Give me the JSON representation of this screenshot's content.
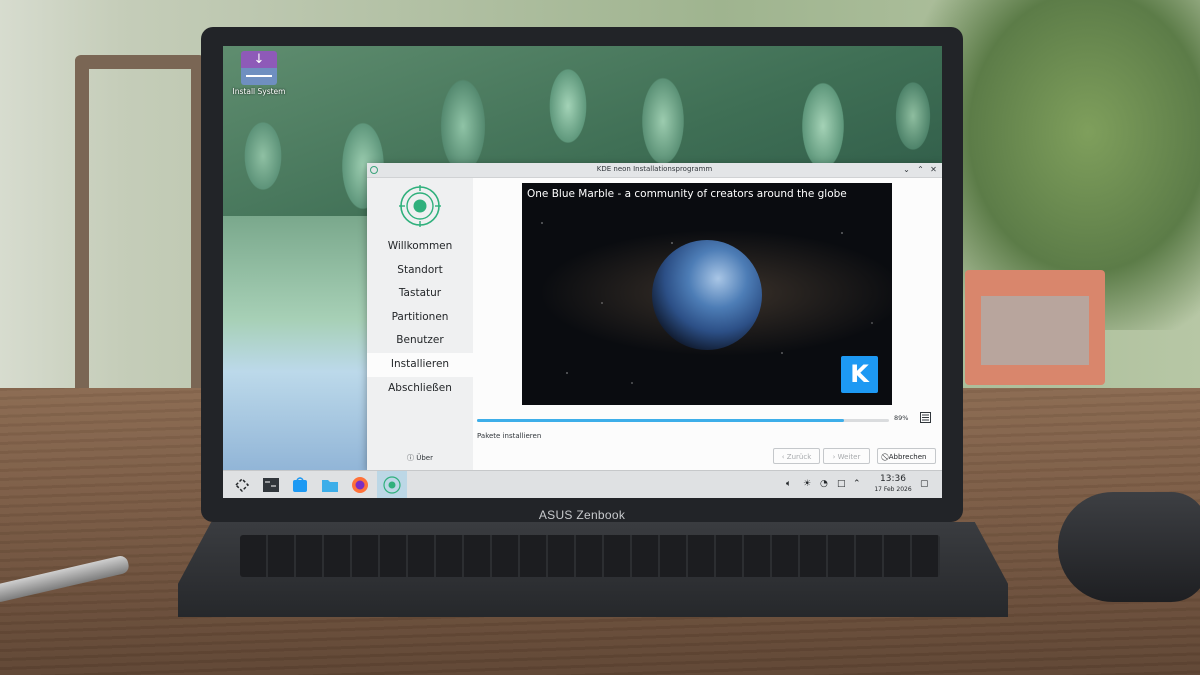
{
  "laptop": {
    "brand": "ASUS Zenbook"
  },
  "desktop": {
    "icon": {
      "label": "Install System",
      "name": "install-system-icon"
    }
  },
  "installer": {
    "title": "KDE neon Installationsprogramm",
    "window_buttons": [
      "chevron-down-icon",
      "chevron-up-icon",
      "close-icon"
    ],
    "steps": [
      {
        "label": "Willkommen"
      },
      {
        "label": "Standort"
      },
      {
        "label": "Tastatur"
      },
      {
        "label": "Partitionen"
      },
      {
        "label": "Benutzer"
      },
      {
        "label": "Installieren",
        "active": true
      },
      {
        "label": "Abschließen"
      }
    ],
    "about_label": "Über",
    "slide": {
      "caption": "One Blue Marble - a community of creators around the globe",
      "logo": "K"
    },
    "progress": {
      "value": 0.89,
      "label": "89%"
    },
    "status": "Pakete installieren",
    "buttons": {
      "back": "Zurück",
      "next": "Weiter",
      "cancel": "Abbrechen"
    }
  },
  "taskbar": {
    "apps": [
      "application-launcher-icon",
      "terminal-icon",
      "discover-store-icon",
      "file-manager-icon",
      "firefox-icon",
      "installer-icon"
    ],
    "tray": [
      "volume-icon",
      "brightness-icon",
      "network-icon",
      "clipboard-icon",
      "chevron-up-icon"
    ],
    "time": "13:36",
    "date": "17 Feb 2026"
  },
  "colors": {
    "accent": "#3daee9",
    "kde_blue": "#1d99f3",
    "taskbar": "#dfe1e3"
  }
}
